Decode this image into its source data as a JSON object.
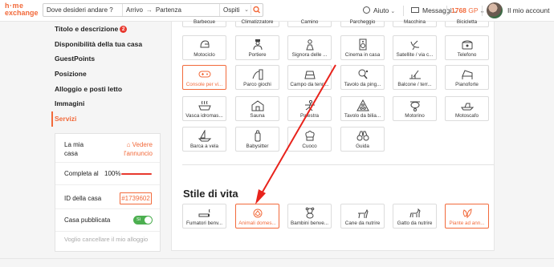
{
  "header": {
    "logo_line1": "h·me",
    "logo_line2": "exchange",
    "search_destination": "Dove desideri andare ?",
    "search_arrival": "Arrivo",
    "search_arrow": "→",
    "search_departure": "Partenza",
    "search_guests": "Ospiti",
    "help": "Aiuto",
    "messages": "Messaggi",
    "guestpoints_value": "1768",
    "guestpoints_unit": "GP",
    "account": "Il mio account",
    "accent_color": "#f26a3b"
  },
  "sidebar": {
    "items": [
      {
        "label": "Titolo e descrizione",
        "badge": "2"
      },
      {
        "label": "Disponibilità della tua casa"
      },
      {
        "label": "GuestPoints"
      },
      {
        "label": "Posizione"
      },
      {
        "label": "Alloggio e posti letto"
      },
      {
        "label": "Immagini"
      },
      {
        "label": "Servizi",
        "active": true
      }
    ]
  },
  "listing_box": {
    "house_label_1": "La mia",
    "house_label_2": "casa",
    "see_ad_1": "Vedere",
    "see_ad_2": "l'annuncio",
    "completed_label": "Completa al",
    "completed_value": "100%",
    "completed_fraction": 1.0,
    "id_label": "ID della casa",
    "id_value": "#1739602",
    "published_label": "Casa pubblicata",
    "published_toggle": "Sì",
    "cancel_link": "Voglio cancellare il mio alloggio"
  },
  "amenities": {
    "row_cut": [
      "Barbecue",
      "Climatizzatore",
      "Camino",
      "Parcheggio",
      "Macchina",
      "Bicicletta"
    ],
    "row1": [
      {
        "label": "Motociclo",
        "icon": "motorcycle-helmet-icon"
      },
      {
        "label": "Portiere",
        "icon": "doorman-icon"
      },
      {
        "label": "Signora delle ...",
        "icon": "cleaning-lady-icon"
      },
      {
        "label": "Cinema in casa",
        "icon": "speaker-icon"
      },
      {
        "label": "Satellite / via c...",
        "icon": "satellite-dish-icon"
      },
      {
        "label": "Telefono",
        "icon": "telephone-icon"
      }
    ],
    "row2": [
      {
        "label": "Console per vi...",
        "icon": "gamepad-icon",
        "selected": true
      },
      {
        "label": "Parco giochi",
        "icon": "slide-icon"
      },
      {
        "label": "Campo da tenn...",
        "icon": "tennis-court-icon"
      },
      {
        "label": "Tavolo da ping...",
        "icon": "ping-pong-icon"
      },
      {
        "label": "Balcone / terr...",
        "icon": "balcony-icon"
      },
      {
        "label": "Pianoforte",
        "icon": "piano-icon"
      }
    ],
    "row3": [
      {
        "label": "Vasca idromas...",
        "icon": "jacuzzi-icon"
      },
      {
        "label": "Sauna",
        "icon": "sauna-icon"
      },
      {
        "label": "Palestra",
        "icon": "gym-icon"
      },
      {
        "label": "Tavolo da bilia...",
        "icon": "billiard-icon"
      },
      {
        "label": "Motorino",
        "icon": "scooter-icon"
      },
      {
        "label": "Motoscafo",
        "icon": "motorboat-icon"
      }
    ],
    "row4": [
      {
        "label": "Barca a vela",
        "icon": "sailboat-icon"
      },
      {
        "label": "Babysitter",
        "icon": "baby-bottle-icon"
      },
      {
        "label": "Cuoco",
        "icon": "chef-hat-icon"
      },
      {
        "label": "Guida",
        "icon": "binoculars-icon"
      }
    ]
  },
  "lifestyle": {
    "title": "Stile di vita",
    "items": [
      {
        "label": "Fumatori benv...",
        "icon": "cigarette-icon"
      },
      {
        "label": "Animali domes...",
        "icon": "pet-icon",
        "selected": true
      },
      {
        "label": "Bambini benve...",
        "icon": "teddy-bear-icon"
      },
      {
        "label": "Cane da nutrire",
        "icon": "dog-icon"
      },
      {
        "label": "Gatto da nutrire",
        "icon": "cat-icon"
      },
      {
        "label": "Piante ad ann...",
        "icon": "plant-icon",
        "selected": true
      }
    ]
  }
}
